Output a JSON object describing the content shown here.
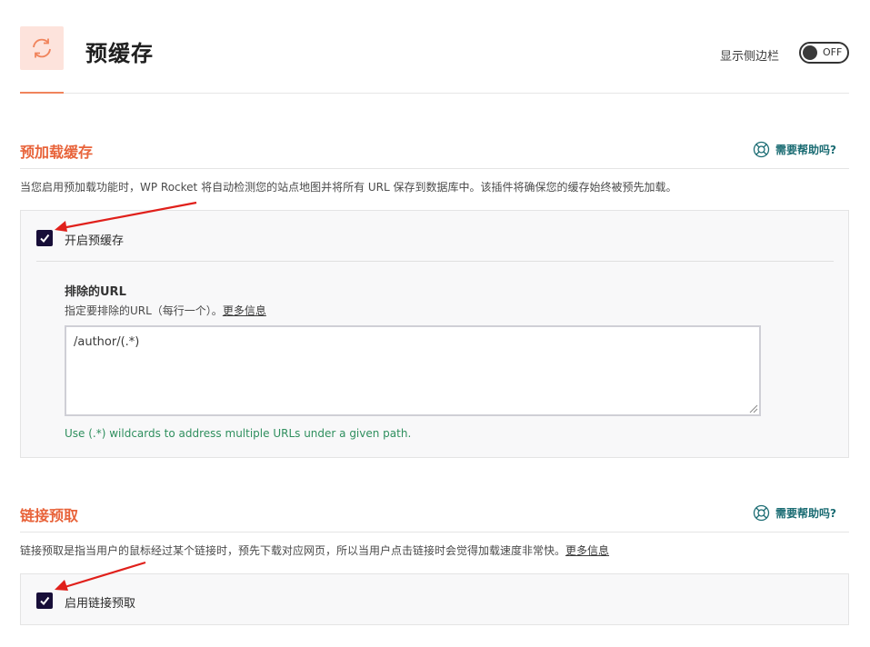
{
  "header": {
    "title": "预缓存",
    "sidebar_label": "显示侧边栏",
    "toggle_state": "OFF"
  },
  "preload": {
    "title": "预加载缓存",
    "help": "需要帮助吗?",
    "description": "当您启用预加载功能时，WP Rocket 将自动检测您的站点地图并将所有 URL 保存到数据库中。该插件将确保您的缓存始终被预先加载。",
    "checkbox_label": "开启预缓存",
    "checked": true,
    "exclude": {
      "title": "排除的URL",
      "description": "指定要排除的URL（每行一个）。",
      "more_link": "更多信息",
      "value": "/author/(.*)",
      "hint": "Use (.*) wildcards to address multiple URLs under a given path."
    }
  },
  "prefetch": {
    "title": "链接预取",
    "help": "需要帮助吗?",
    "description": "链接预取是指当用户的鼠标经过某个链接时，预先下载对应网页，所以当用户点击链接时会觉得加载速度非常快。",
    "more_link": "更多信息",
    "checkbox_label": "启用链接预取",
    "checked": true
  },
  "colors": {
    "accent": "#e8633a",
    "checkbox": "#170e38",
    "help": "#1b6c73",
    "hint": "#2f8f5e",
    "arrow": "#e0201b"
  }
}
